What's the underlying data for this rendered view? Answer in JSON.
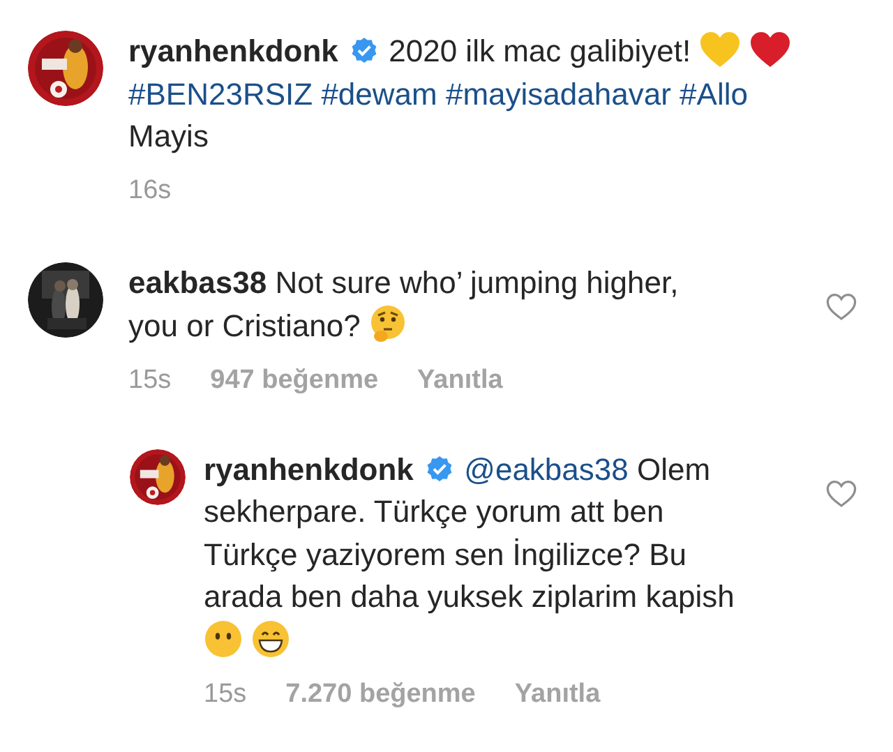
{
  "post": {
    "username": "ryanhenkdonk",
    "verified": true,
    "segments": [
      {
        "kind": "text",
        "text": "2020 ilk mac galibiyet!"
      },
      {
        "kind": "heart_emoji",
        "color": "#f7c31e"
      },
      {
        "kind": "heart_emoji",
        "color": "#d81e2a"
      },
      {
        "kind": "tag",
        "text": "#BEN23RSIZ"
      },
      {
        "kind": "tag",
        "text": "#dewam"
      },
      {
        "kind": "tag",
        "text": "#mayisadahavar"
      },
      {
        "kind": "tag",
        "text": "#Allo"
      },
      {
        "kind": "text",
        "text": "Mayis"
      }
    ],
    "time": "16s"
  },
  "comments": [
    {
      "username": "eakbas38",
      "verified": false,
      "reply": false,
      "segments": [
        {
          "kind": "text",
          "text": "Not sure who’ jumping higher,"
        },
        {
          "kind": "text",
          "text": "you or Cristiano?"
        },
        {
          "kind": "thinking_emoji"
        }
      ],
      "time": "15s",
      "likes": "947 beğenme",
      "reply_label": "Yanıtla"
    },
    {
      "username": "ryanhenkdonk",
      "verified": true,
      "reply": true,
      "segments": [
        {
          "kind": "mention",
          "text": "@eakbas38"
        },
        {
          "kind": "text",
          "text": "Olem"
        },
        {
          "kind": "text",
          "text": "sekherpare. Türkçe yorum att ben Türkçe yaziyorem sen İngilizce? Bu arada ben daha yuksek ziplarim kapish"
        },
        {
          "kind": "neutral_emoji"
        },
        {
          "kind": "grin_emoji"
        }
      ],
      "time": "15s",
      "likes": "7.270 beğenme",
      "reply_label": "Yanıtla"
    }
  ]
}
